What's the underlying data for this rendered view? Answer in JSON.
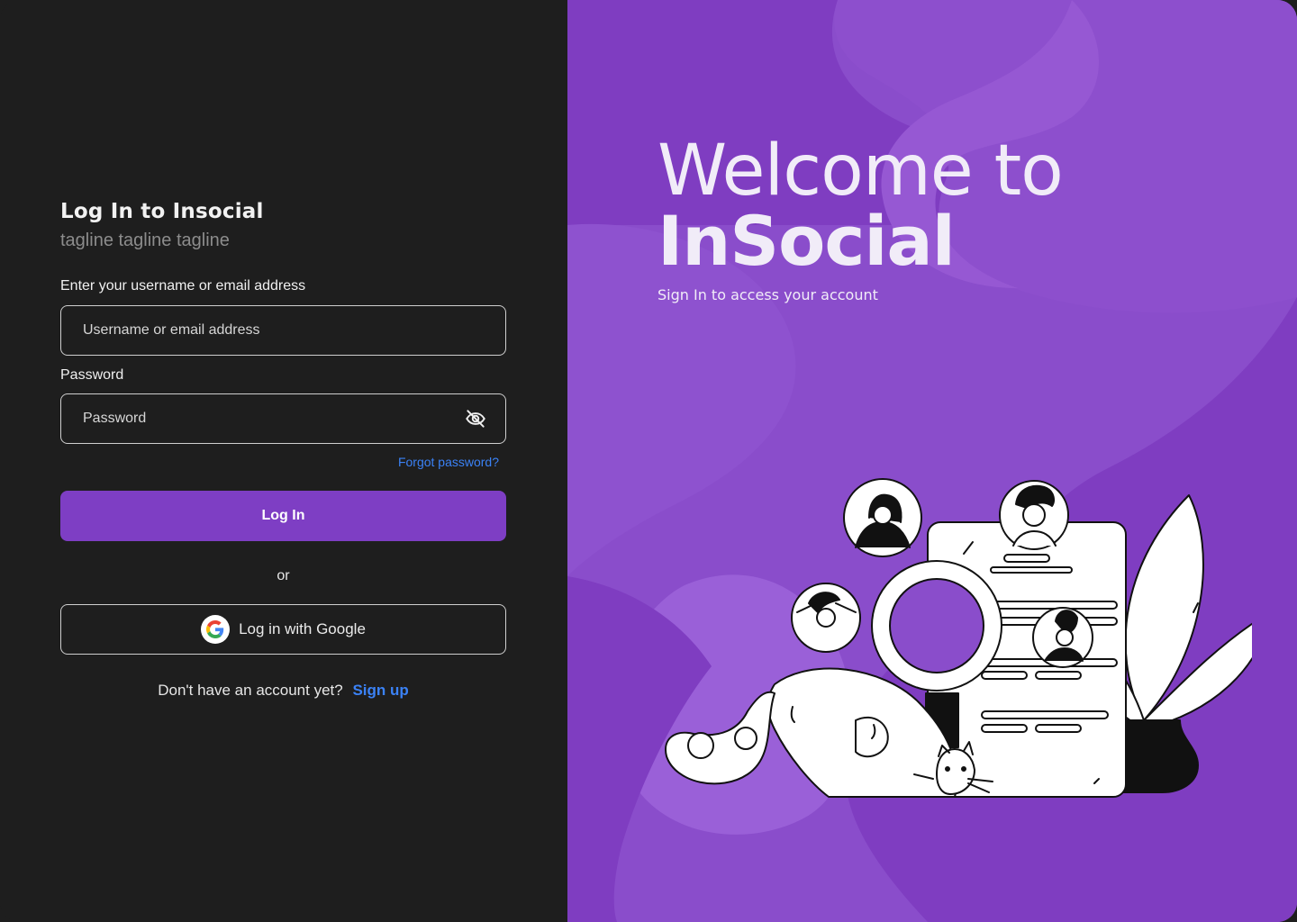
{
  "login": {
    "title": "Log In to Insocial",
    "tagline": "tagline tagline tagline",
    "username_label": "Enter your username or email address",
    "username_placeholder": "Username or email address",
    "password_label": "Password",
    "password_placeholder": "Password",
    "forgot_link": "Forgot password?",
    "login_button": "Log In",
    "or_text": "or",
    "google_button": "Log in with Google",
    "signup_prompt": "Don't have an account yet?",
    "signup_link": "Sign up"
  },
  "hero": {
    "welcome_line1": "Welcome to",
    "welcome_line2": "InSocial",
    "subtitle": "Sign In to access your account"
  },
  "colors": {
    "left_bg": "#1e1e1e",
    "right_bg": "#8a4dcb",
    "accent_button": "#7e3ec4",
    "link": "#3b82f6"
  },
  "icons": {
    "password_toggle": "eye-off-icon",
    "google": "google-icon"
  }
}
